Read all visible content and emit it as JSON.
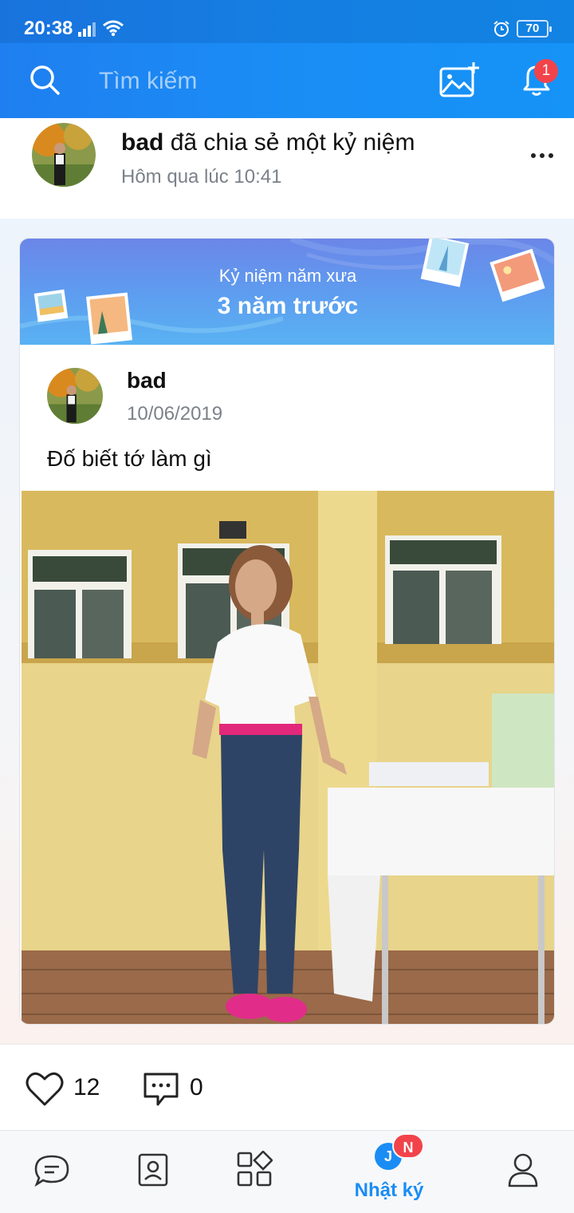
{
  "status_bar": {
    "time": "20:38",
    "battery": "70"
  },
  "search": {
    "placeholder": "Tìm kiếm"
  },
  "notifications": {
    "badge_count": "1"
  },
  "share": {
    "author": "bad",
    "action": "đã chia sẻ một kỷ niệm",
    "timestamp": "Hôm qua lúc 10:41"
  },
  "memory": {
    "label": "Kỷ niệm năm xưa",
    "years_ago": "3 năm trước"
  },
  "post": {
    "author": "bad",
    "date": "10/06/2019",
    "text": "Đố biết tớ làm gì"
  },
  "reactions": {
    "likes": "12",
    "comments": "0"
  },
  "bottom_nav": {
    "items": [
      {
        "name": "messages",
        "icon": "chat-icon"
      },
      {
        "name": "contacts",
        "icon": "contact-card-icon"
      },
      {
        "name": "discover",
        "icon": "grid-icon"
      },
      {
        "name": "timeline",
        "icon": "timeline-icon",
        "label": "Nhật ký",
        "active": true,
        "badge": "N"
      },
      {
        "name": "profile",
        "icon": "person-icon"
      }
    ]
  },
  "colors": {
    "accent": "#1a8df5",
    "badge": "#f2434a"
  }
}
